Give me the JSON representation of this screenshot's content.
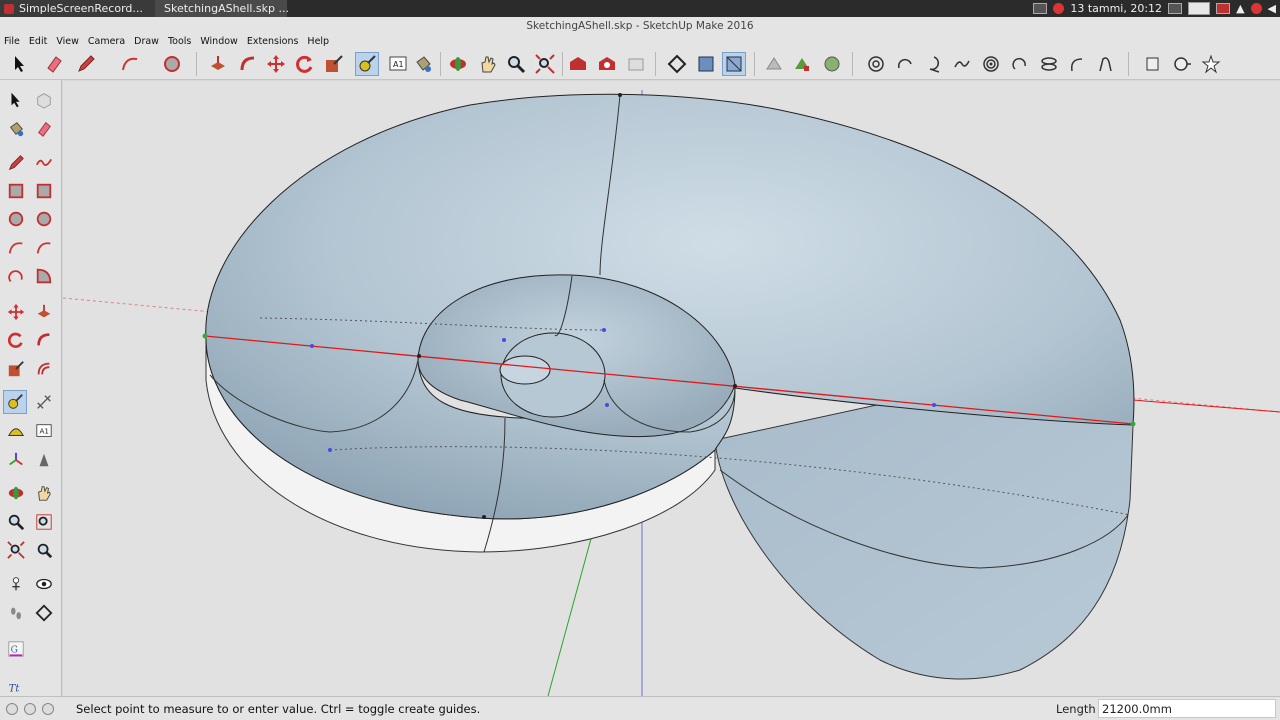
{
  "taskbar": {
    "tasks": [
      {
        "label": "SimpleScreenRecord...",
        "icon": "screen-recorder-icon"
      },
      {
        "label": "SketchingAShell.skp ...",
        "icon": "sketchup-icon"
      }
    ],
    "clock": "13 tammi, 20:12"
  },
  "window": {
    "title": "SketchingAShell.skp - SketchUp Make 2016"
  },
  "menu": [
    "File",
    "Edit",
    "View",
    "Camera",
    "Draw",
    "Tools",
    "Window",
    "Extensions",
    "Help"
  ],
  "toolbar": {
    "tools": [
      "select-icon",
      "eraser-icon",
      "pencil-icon",
      "arc-icon",
      "circle-icon",
      "push-pull-icon",
      "follow-me-icon",
      "move-icon",
      "rotate-icon",
      "scale-icon",
      "tape-measure-icon",
      "text-icon",
      "paint-bucket-icon",
      "orbit-icon",
      "pan-icon",
      "zoom-icon",
      "zoom-extents-icon",
      "warehouse-icon",
      "extension-warehouse-icon",
      "share-model-icon",
      "section-plane-icon",
      "x-ray-icon",
      "back-edges-icon",
      "sandbox-icon",
      "sandbox-stamp-icon",
      "sandbox-drape-icon",
      "spiral-1-icon",
      "spiral-2-icon",
      "spiral-3-icon",
      "spiral-4-icon",
      "spiral-5-icon",
      "spiral-6-icon",
      "spiral-7-icon",
      "spiral-8-icon",
      "spiral-9-icon",
      "component-icon",
      "solid-tools-icon",
      "star-icon"
    ],
    "selected": "tape-measure-icon"
  },
  "colors": {
    "shell_fill": "#b9cad6",
    "shell_dark": "#8fa4b4",
    "shell_underside": "#f4f4f4",
    "red_axis": "#e01818",
    "green_axis": "#2aa52a",
    "blue_axis": "#3a3ae0",
    "selected_tool": "#bcd2ea"
  },
  "status": {
    "message": "Select point to measure to or enter value.  Ctrl = toggle create guides.",
    "measure_label": "Length",
    "measure_value": "21200.0mm"
  }
}
